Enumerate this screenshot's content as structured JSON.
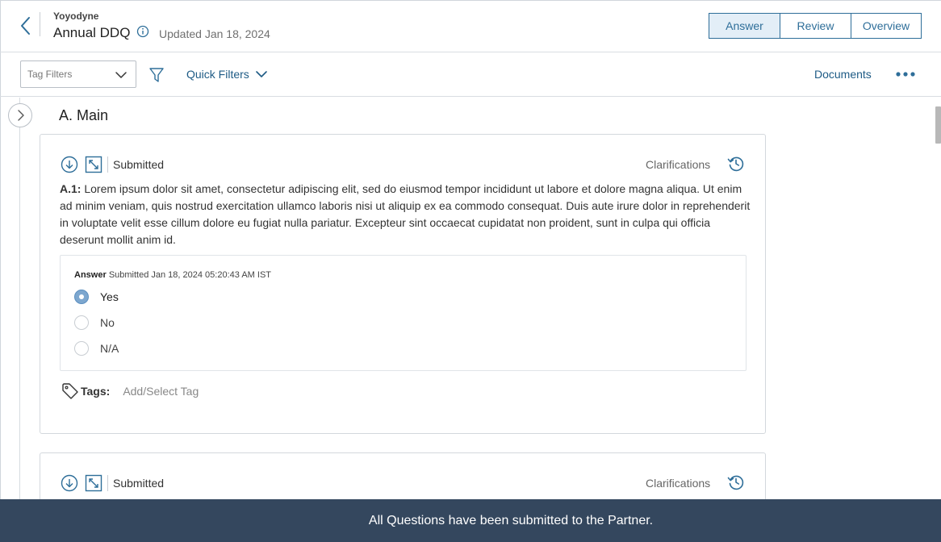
{
  "header": {
    "org": "Yoyodyne",
    "title": "Annual DDQ",
    "updated": "Updated Jan 18, 2024",
    "tabs": [
      "Answer",
      "Review",
      "Overview"
    ],
    "active_tab": "Answer"
  },
  "toolbar": {
    "tag_filter_placeholder": "Tag Filters",
    "quick_filters_label": "Quick Filters",
    "documents_label": "Documents"
  },
  "section": {
    "title": "A. Main"
  },
  "questions": [
    {
      "status": "Submitted",
      "clarifications_label": "Clarifications",
      "id_label": "A.1:",
      "text": "Lorem ipsum dolor sit amet, consectetur adipiscing elit, sed do eiusmod tempor incididunt ut labore et dolore magna aliqua. Ut enim ad minim veniam, quis nostrud exercitation ullamco laboris nisi ut aliquip ex ea commodo consequat. Duis aute irure dolor in reprehenderit in voluptate velit esse cillum dolore eu fugiat nulla pariatur. Excepteur sint occaecat cupidatat non proident, sunt in culpa qui officia deserunt mollit anim id.",
      "answer_label": "Answer",
      "answer_meta": "Submitted Jan 18, 2024 05:20:43 AM IST",
      "options": [
        "Yes",
        "No",
        "N/A"
      ],
      "selected_option": "Yes",
      "tags_label": "Tags:",
      "tags_placeholder": "Add/Select Tag"
    },
    {
      "status": "Submitted",
      "clarifications_label": "Clarifications"
    }
  ],
  "banner": {
    "text": "All Questions have been submitted to the Partner."
  },
  "colors": {
    "accent": "#2e6e99",
    "link": "#1e5b85",
    "banner_bg": "#34475e",
    "active_tab_bg": "#e3eef7"
  },
  "icons": [
    "back-arrow-icon",
    "info-icon",
    "chevron-down-icon",
    "filter-funnel-icon",
    "more-horizontal-icon",
    "chevron-right-icon",
    "download-circle-icon",
    "expand-diagonal-icon",
    "history-icon",
    "tag-icon"
  ]
}
